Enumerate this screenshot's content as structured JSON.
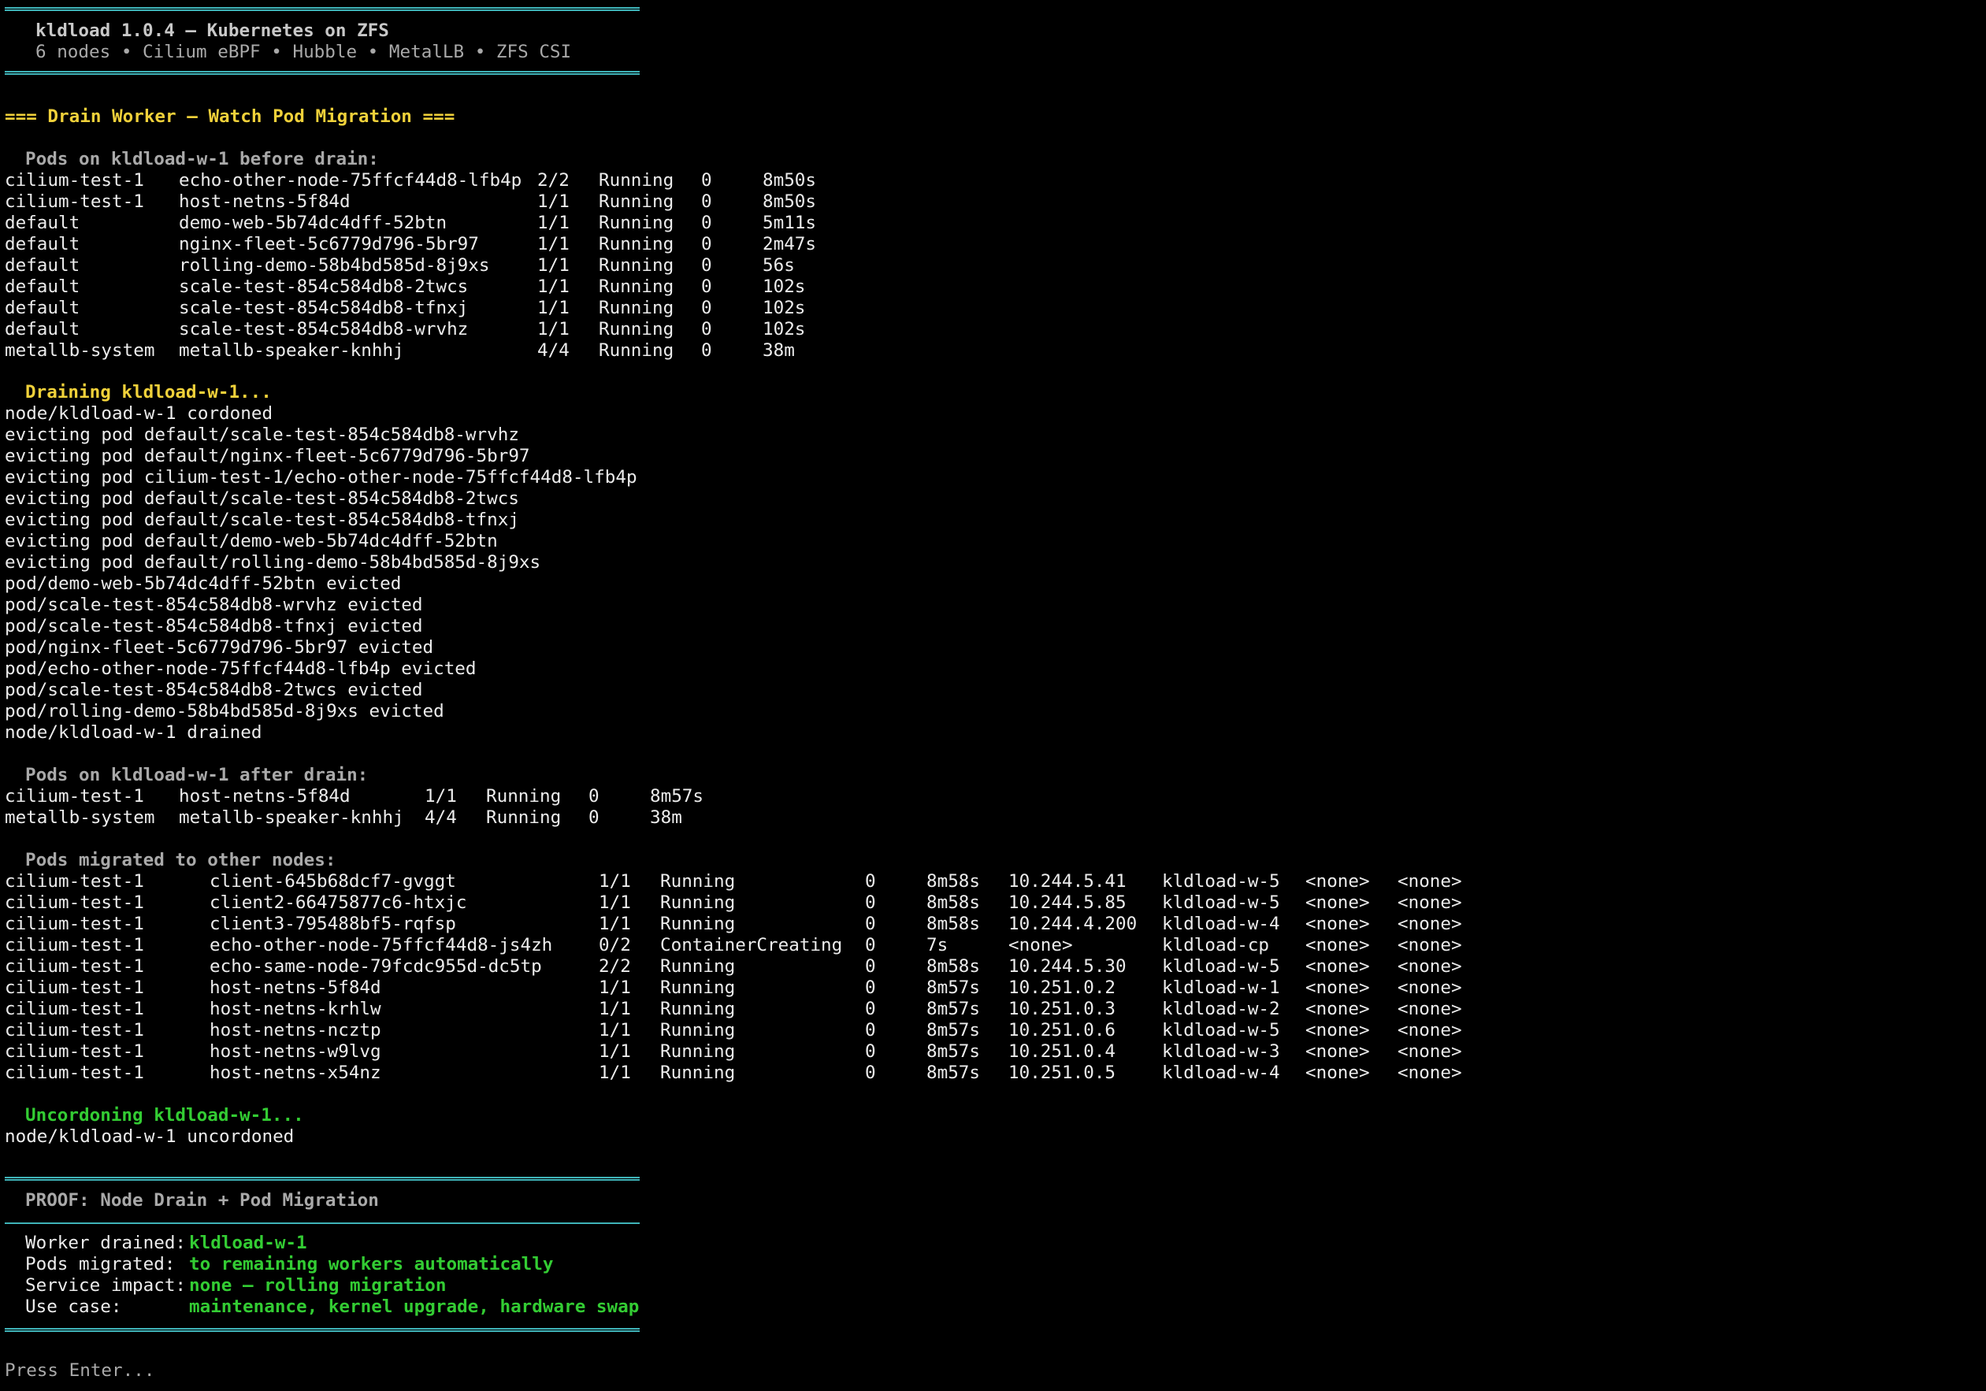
{
  "banner": {
    "title": "kldload 1.0.4 — Kubernetes on ZFS",
    "subtitle": "6 nodes • Cilium eBPF • Hubble • MetalLB • ZFS CSI"
  },
  "section_title": "=== Drain Worker — Watch Pod Migration ===",
  "before": {
    "heading": "Pods on kldload-w-1 before drain:",
    "rows": [
      [
        "cilium-test-1",
        "echo-other-node-75ffcf44d8-lfb4p",
        "2/2",
        "Running",
        "0",
        "8m50s"
      ],
      [
        "cilium-test-1",
        "host-netns-5f84d",
        "1/1",
        "Running",
        "0",
        "8m50s"
      ],
      [
        "default",
        "demo-web-5b74dc4dff-52btn",
        "1/1",
        "Running",
        "0",
        "5m11s"
      ],
      [
        "default",
        "nginx-fleet-5c6779d796-5br97",
        "1/1",
        "Running",
        "0",
        "2m47s"
      ],
      [
        "default",
        "rolling-demo-58b4bd585d-8j9xs",
        "1/1",
        "Running",
        "0",
        "56s"
      ],
      [
        "default",
        "scale-test-854c584db8-2twcs",
        "1/1",
        "Running",
        "0",
        "102s"
      ],
      [
        "default",
        "scale-test-854c584db8-tfnxj",
        "1/1",
        "Running",
        "0",
        "102s"
      ],
      [
        "default",
        "scale-test-854c584db8-wrvhz",
        "1/1",
        "Running",
        "0",
        "102s"
      ],
      [
        "metallb-system",
        "metallb-speaker-knhhj",
        "4/4",
        "Running",
        "0",
        "38m"
      ]
    ]
  },
  "drain": {
    "heading": "Draining kldload-w-1...",
    "log": [
      "node/kldload-w-1 cordoned",
      "evicting pod default/scale-test-854c584db8-wrvhz",
      "evicting pod default/nginx-fleet-5c6779d796-5br97",
      "evicting pod cilium-test-1/echo-other-node-75ffcf44d8-lfb4p",
      "evicting pod default/scale-test-854c584db8-2twcs",
      "evicting pod default/scale-test-854c584db8-tfnxj",
      "evicting pod default/demo-web-5b74dc4dff-52btn",
      "evicting pod default/rolling-demo-58b4bd585d-8j9xs",
      "pod/demo-web-5b74dc4dff-52btn evicted",
      "pod/scale-test-854c584db8-wrvhz evicted",
      "pod/scale-test-854c584db8-tfnxj evicted",
      "pod/nginx-fleet-5c6779d796-5br97 evicted",
      "pod/echo-other-node-75ffcf44d8-lfb4p evicted",
      "pod/scale-test-854c584db8-2twcs evicted",
      "pod/rolling-demo-58b4bd585d-8j9xs evicted",
      "node/kldload-w-1 drained"
    ]
  },
  "after": {
    "heading": "Pods on kldload-w-1 after drain:",
    "rows": [
      [
        "cilium-test-1",
        "host-netns-5f84d",
        "1/1",
        "Running",
        "0",
        "8m57s"
      ],
      [
        "metallb-system",
        "metallb-speaker-knhhj",
        "4/4",
        "Running",
        "0",
        "38m"
      ]
    ]
  },
  "migrated": {
    "heading": "Pods migrated to other nodes:",
    "rows": [
      [
        "cilium-test-1",
        "client-645b68dcf7-gvggt",
        "1/1",
        "Running",
        "0",
        "8m58s",
        "10.244.5.41",
        "kldload-w-5",
        "<none>",
        "<none>"
      ],
      [
        "cilium-test-1",
        "client2-66475877c6-htxjc",
        "1/1",
        "Running",
        "0",
        "8m58s",
        "10.244.5.85",
        "kldload-w-5",
        "<none>",
        "<none>"
      ],
      [
        "cilium-test-1",
        "client3-795488bf5-rqfsp",
        "1/1",
        "Running",
        "0",
        "8m58s",
        "10.244.4.200",
        "kldload-w-4",
        "<none>",
        "<none>"
      ],
      [
        "cilium-test-1",
        "echo-other-node-75ffcf44d8-js4zh",
        "0/2",
        "ContainerCreating",
        "0",
        "7s",
        "<none>",
        "kldload-cp",
        "<none>",
        "<none>"
      ],
      [
        "cilium-test-1",
        "echo-same-node-79fcdc955d-dc5tp",
        "2/2",
        "Running",
        "0",
        "8m58s",
        "10.244.5.30",
        "kldload-w-5",
        "<none>",
        "<none>"
      ],
      [
        "cilium-test-1",
        "host-netns-5f84d",
        "1/1",
        "Running",
        "0",
        "8m57s",
        "10.251.0.2",
        "kldload-w-1",
        "<none>",
        "<none>"
      ],
      [
        "cilium-test-1",
        "host-netns-krhlw",
        "1/1",
        "Running",
        "0",
        "8m57s",
        "10.251.0.3",
        "kldload-w-2",
        "<none>",
        "<none>"
      ],
      [
        "cilium-test-1",
        "host-netns-ncztp",
        "1/1",
        "Running",
        "0",
        "8m57s",
        "10.251.0.6",
        "kldload-w-5",
        "<none>",
        "<none>"
      ],
      [
        "cilium-test-1",
        "host-netns-w9lvg",
        "1/1",
        "Running",
        "0",
        "8m57s",
        "10.251.0.4",
        "kldload-w-3",
        "<none>",
        "<none>"
      ],
      [
        "cilium-test-1",
        "host-netns-x54nz",
        "1/1",
        "Running",
        "0",
        "8m57s",
        "10.251.0.5",
        "kldload-w-4",
        "<none>",
        "<none>"
      ]
    ]
  },
  "uncordon": {
    "heading": "Uncordoning kldload-w-1...",
    "log": "node/kldload-w-1 uncordoned"
  },
  "proof": {
    "title": "PROOF: Node Drain + Pod Migration",
    "items": [
      {
        "label": "Worker drained:",
        "value": "kldload-w-1"
      },
      {
        "label": "Pods migrated:",
        "value": "to remaining workers automatically"
      },
      {
        "label": "Service impact:",
        "value": "none — rolling migration"
      },
      {
        "label": "Use case:",
        "value": "maintenance, kernel upgrade, hardware swap"
      }
    ]
  },
  "prompt": "Press Enter...",
  "colors": {
    "background": "#000000",
    "text": "#ececec",
    "dim": "#a9a9a9",
    "heading_yellow": "#f0d13a",
    "heading_green": "#33cc33",
    "rule_cyan": "#3fb3b8"
  }
}
